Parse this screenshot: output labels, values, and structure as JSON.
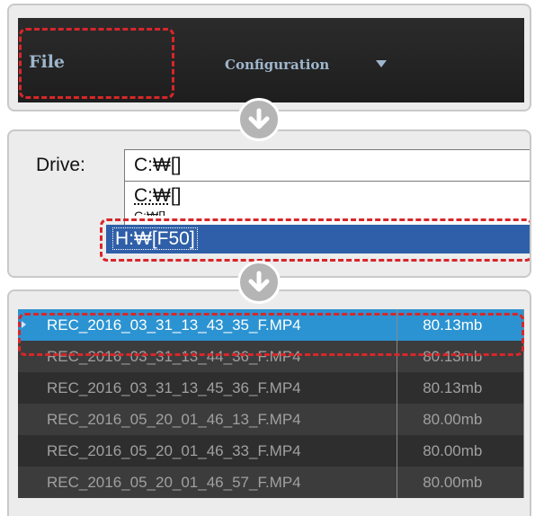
{
  "step1": {
    "menu": {
      "file_label": "File",
      "configuration_label": "Configuration"
    }
  },
  "step2": {
    "drive_label": "Drive:",
    "selected_value": "C:₩[]",
    "options": [
      "C:₩[]",
      "H:₩[F50]"
    ]
  },
  "step3": {
    "files": [
      {
        "name": "REC_2016_03_31_13_43_35_F.MP4",
        "size": "80.13mb"
      },
      {
        "name": "REC_2016_03_31_13_44_36_F.MP4",
        "size": "80.13mb"
      },
      {
        "name": "REC_2016_03_31_13_45_36_F.MP4",
        "size": "80.13mb"
      },
      {
        "name": "REC_2016_05_20_01_46_13_F.MP4",
        "size": "80.00mb"
      },
      {
        "name": "REC_2016_05_20_01_46_33_F.MP4",
        "size": "80.00mb"
      },
      {
        "name": "REC_2016_05_20_01_46_57_F.MP4",
        "size": "80.00mb"
      }
    ]
  },
  "colors": {
    "highlight": "#d8262a",
    "selection_blue": "#2b93d2",
    "dropdown_selection": "#2f5fa8",
    "menu_text": "#9fb6cc"
  },
  "icons": {
    "step_arrow": "arrow-down-circle-icon",
    "dropdown_caret": "caret-down-icon"
  }
}
